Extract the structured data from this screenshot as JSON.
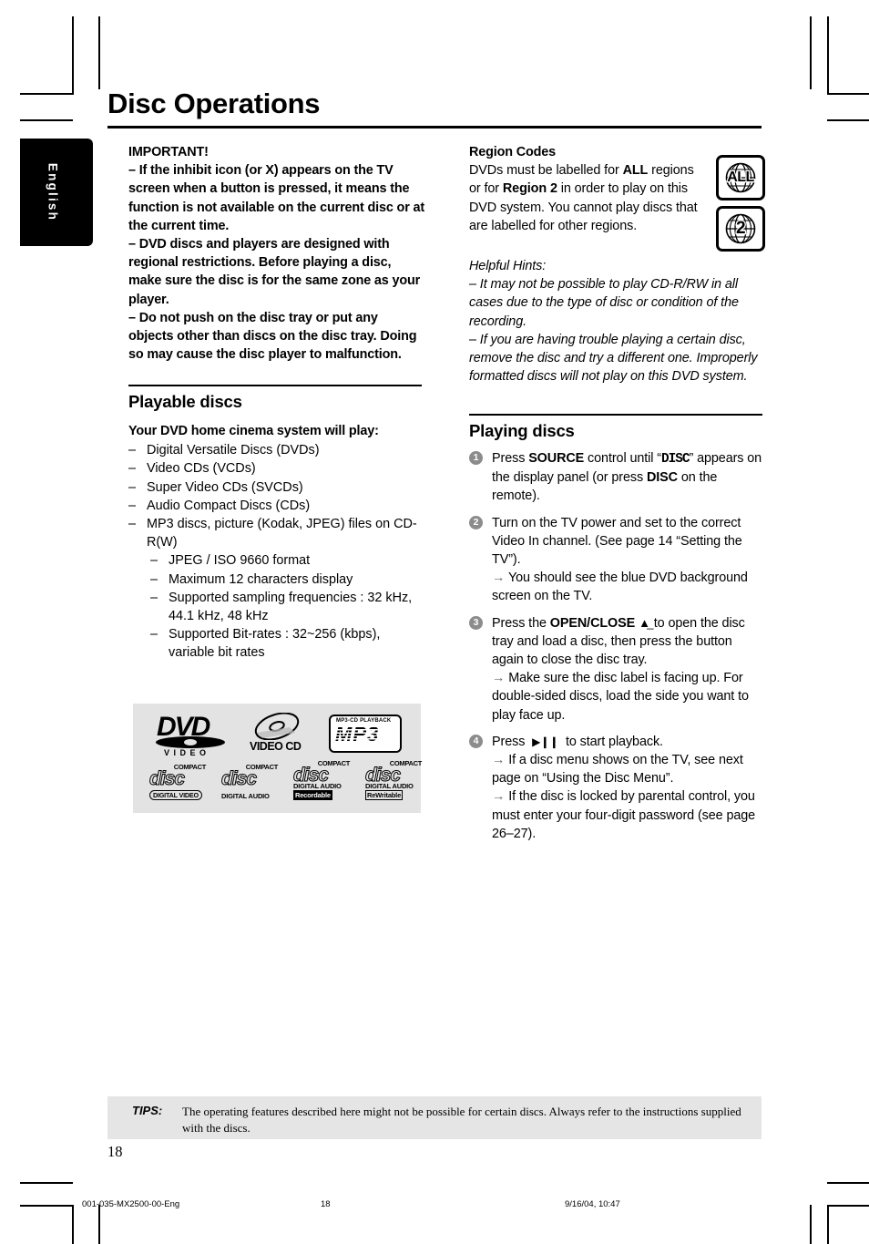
{
  "page": {
    "title": "Disc Operations",
    "language_tab": "English",
    "page_number": "18"
  },
  "left_column": {
    "important": {
      "heading": "IMPORTANT!",
      "lines": [
        "– If the inhibit icon (or X) appears on the TV screen when a button is pressed, it means the function is not available on the current disc or at the current time.",
        "–  DVD discs and players are designed with regional restrictions. Before playing a disc, make sure the disc is for the same zone as your player.",
        "–  Do not push on the disc tray or put any objects other than discs on the disc tray.  Doing so may cause the disc player to malfunction."
      ]
    },
    "playable_discs": {
      "heading": "Playable discs",
      "intro": "Your DVD home cinema system will play:",
      "items": [
        "Digital Versatile Discs (DVDs)",
        "Video CDs (VCDs)",
        "Super Video CDs (SVCDs)",
        "Audio Compact Discs (CDs)",
        "MP3 discs, picture (Kodak, JPEG) files on CD-R(W)"
      ],
      "sub_items": [
        "JPEG / ISO 9660 format",
        "Maximum 12 characters display",
        "Supported sampling frequencies : 32 kHz, 44.1 kHz, 48 kHz",
        "Supported Bit-rates : 32~256 (kbps), variable bit rates"
      ]
    },
    "disc_logos": {
      "dvd_video": {
        "main": "DVD",
        "sub": "V I D E O"
      },
      "video_cd": {
        "label": "VIDEO CD"
      },
      "mp3": {
        "top": "MP3-CD PLAYBACK",
        "main": "MP3"
      },
      "compact_discs": [
        {
          "cap": "COMPACT",
          "word": "disc",
          "sub": "DIGITAL VIDEO",
          "style": "rounded-box"
        },
        {
          "cap": "COMPACT",
          "word": "disc",
          "sub": "DIGITAL AUDIO",
          "style": "plain"
        },
        {
          "cap": "COMPACT",
          "word": "disc",
          "sub": "DIGITAL AUDIO",
          "sub2": "Recordable",
          "style": "inverse"
        },
        {
          "cap": "COMPACT",
          "word": "disc",
          "sub": "DIGITAL AUDIO",
          "sub2": "ReWritable",
          "style": "outline"
        }
      ]
    }
  },
  "right_column": {
    "region_codes": {
      "heading": "Region Codes",
      "body": "DVDs must be labelled for ALL regions or for Region 2 in order to play on this DVD system. You cannot play discs that are labelled for other regions.",
      "icons": [
        {
          "name": "region-all-icon",
          "label": "ALL"
        },
        {
          "name": "region-2-icon",
          "label": "2"
        }
      ]
    },
    "helpful_hints": {
      "heading": "Helpful Hints:",
      "items": [
        "–  It may not be possible to play CD-R/RW in all cases due to the type of disc or condition of the recording.",
        "–  If you are having trouble playing a certain disc, remove the disc and try a different one. Improperly formatted discs will not play on this DVD system."
      ]
    },
    "playing_discs": {
      "heading": "Playing discs",
      "steps": [
        {
          "num": "1",
          "text": "Press SOURCE control until “DISC” appears on the display panel (or press DISC on the remote).",
          "arrows": []
        },
        {
          "num": "2",
          "text": "Turn on the TV power and set to the correct Video In channel.  (See page 14 “Setting the TV”).",
          "arrows": [
            "You should see the blue DVD background screen on the TV."
          ]
        },
        {
          "num": "3",
          "text": "Press the OPEN/CLOSE ⏏ to open the disc tray and load a disc, then press the button again to close the disc tray.",
          "arrows": [
            "Make sure the disc label is facing up.  For double-sided discs, load the side you want to play face up."
          ]
        },
        {
          "num": "4",
          "text": "Press ▶ ⏸ to start playback.",
          "arrows": [
            "If a disc menu shows on the TV, see next page on “Using the Disc Menu”.",
            "If the disc is locked by parental control, you must enter your four-digit password (see page 26–27)."
          ]
        }
      ]
    }
  },
  "tips": {
    "label": "TIPS:",
    "text": "The operating features described here might not be possible for certain discs.  Always refer to the instructions supplied with the discs."
  },
  "print_footer": {
    "file": "001-035-MX2500-00-Eng",
    "page": "18",
    "date": "9/16/04, 10:47"
  }
}
